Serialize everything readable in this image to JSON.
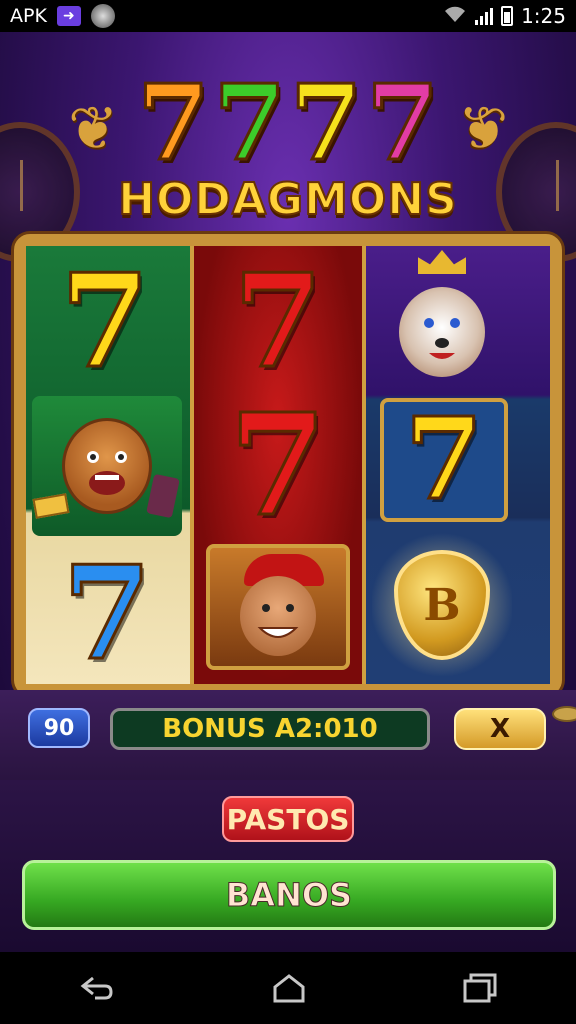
{
  "status_bar": {
    "carrier_label": "APK",
    "time": "1:25",
    "icons": [
      "share-icon",
      "app-icon",
      "wifi-icon",
      "signal-icon",
      "battery-icon"
    ]
  },
  "game": {
    "logo": {
      "sevens": [
        "7",
        "7",
        "7",
        "7"
      ],
      "title": "HODAGMONS"
    },
    "reels": {
      "reel1": {
        "top_symbol": "7",
        "middle_symbol": "lion-character",
        "bottom_symbol": "7"
      },
      "reel2": {
        "top_symbol": "7",
        "middle_symbol": "7",
        "bottom_symbol": "man-character"
      },
      "reel3": {
        "top_symbol": "wolf-king-character",
        "middle_symbol": "7",
        "bottom_symbol": "B"
      }
    },
    "controls": {
      "counter_value": "90",
      "bonus_label": "BONUS A2:010",
      "close_label": "X",
      "pastos_label": "PASTOS",
      "banos_label": "BANOS"
    },
    "colors": {
      "frame_gold": "#c8943a",
      "bonus_text": "#f8d430",
      "banos_green": "#36a822",
      "pastos_red": "#c8161c"
    }
  },
  "nav_bar": {
    "icons": [
      "back-icon",
      "home-icon",
      "recent-apps-icon"
    ]
  }
}
